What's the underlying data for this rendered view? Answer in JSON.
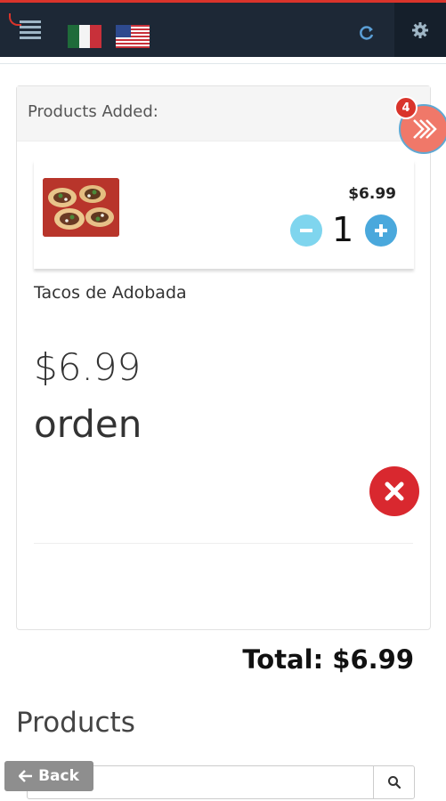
{
  "header": {
    "icons": [
      "menu-icon",
      "mexico-flag-icon",
      "usa-flag-icon",
      "refresh-icon",
      "gear-icon"
    ],
    "flags": {
      "mx": [
        "#1f6b3a",
        "#ffffff",
        "#c8303a"
      ],
      "us": [
        "#2e4a8e",
        "#c8303a",
        "#ffffff"
      ]
    },
    "colors": {
      "bar": "#1d2836",
      "accent": "#d9342b",
      "icon": "#9fb6c6"
    }
  },
  "cart": {
    "title": "Products Added:",
    "count_badge": "4",
    "item": {
      "name": "Tacos de Adobada",
      "price_small": "$6.99",
      "quantity": "1",
      "price_large": "$6.99",
      "unit": "orden"
    },
    "colors": {
      "minus": "#7fd5ee",
      "plus": "#4aa8dc",
      "remove": "#d9282f",
      "collapse": "#f07869"
    }
  },
  "total_label": "Total: $6.99",
  "products": {
    "title": "Products",
    "search_value": "",
    "back_label": "Back"
  }
}
